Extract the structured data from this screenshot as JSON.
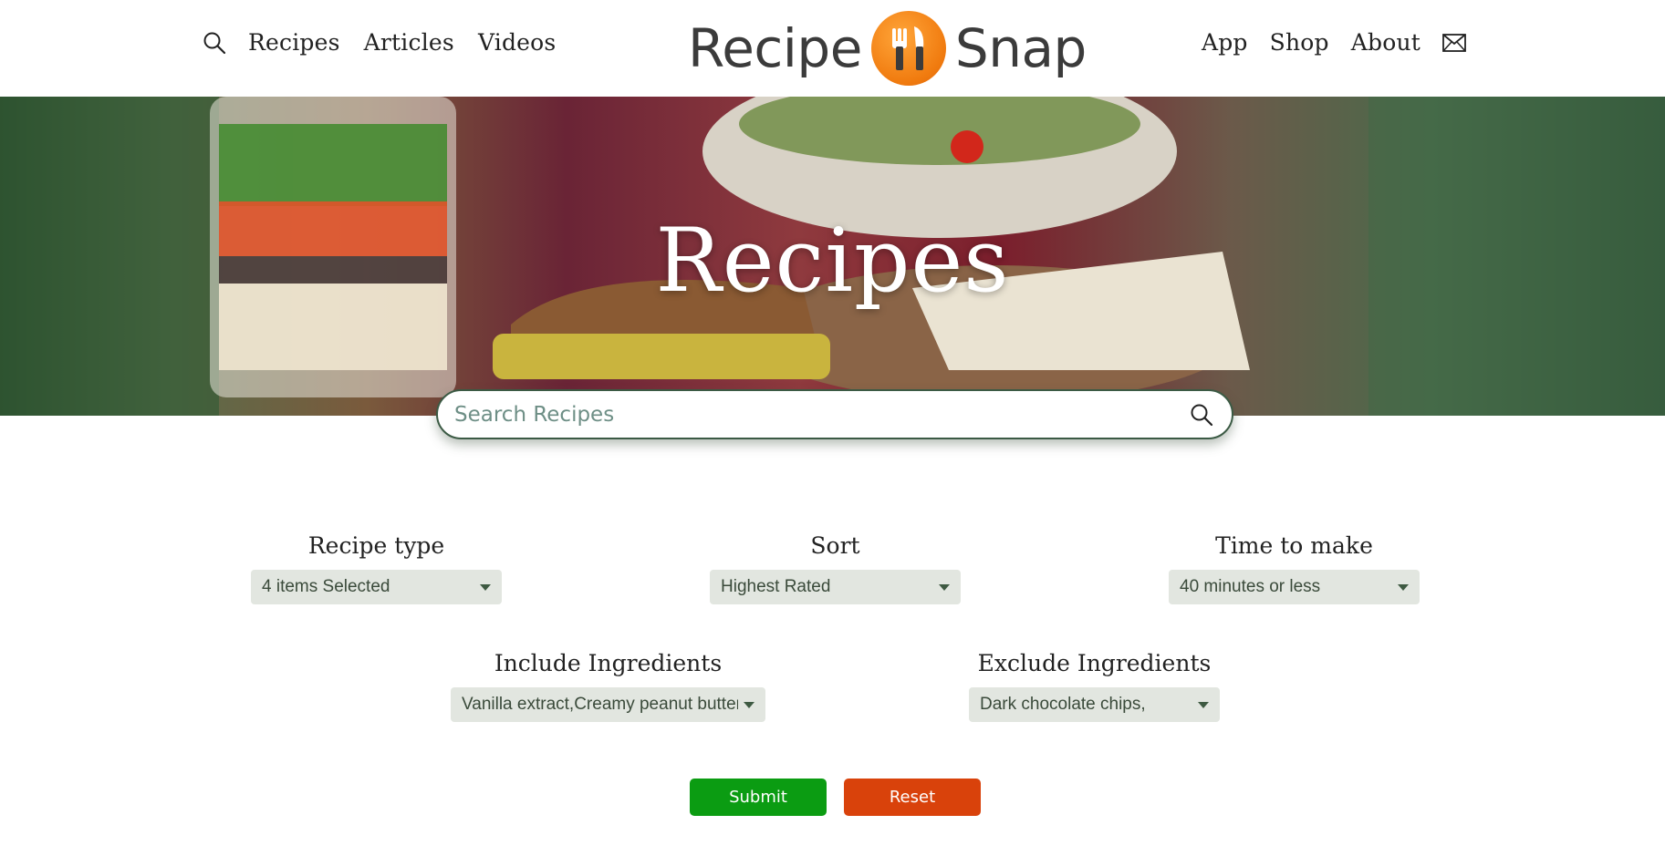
{
  "header": {
    "nav_left": [
      "Recipes",
      "Articles",
      "Videos"
    ],
    "logo": {
      "left_word": "Recipe",
      "right_word": "Snap",
      "badge_icon": "fork-knife-icon",
      "badge_color": "#f08a1c"
    },
    "nav_right": [
      "App",
      "Shop",
      "About"
    ]
  },
  "hero": {
    "title": "Recipes"
  },
  "search": {
    "placeholder": "Search Recipes"
  },
  "filters": {
    "recipe_type": {
      "label": "Recipe type",
      "value": "4 items Selected"
    },
    "sort": {
      "label": "Sort",
      "value": "Highest Rated"
    },
    "time": {
      "label": "Time to make",
      "value": "40 minutes or less"
    },
    "include": {
      "label": "Include Ingredients",
      "value": "Vanilla extract,Creamy peanut butter,"
    },
    "exclude": {
      "label": "Exclude Ingredients",
      "value": "Dark chocolate chips,"
    }
  },
  "buttons": {
    "submit": "Submit",
    "reset": "Reset"
  },
  "colors": {
    "submit": "#0b9c12",
    "reset": "#d9420b",
    "accent": "#3b5a44"
  }
}
